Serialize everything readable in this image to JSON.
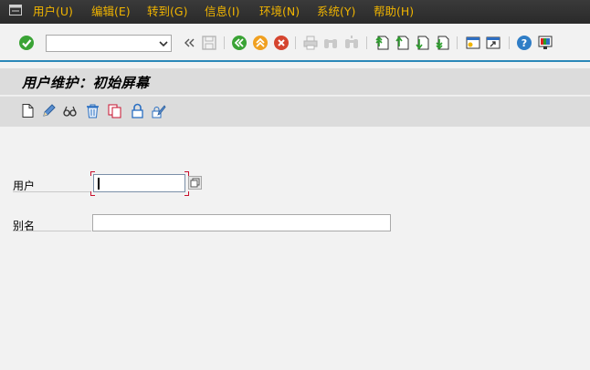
{
  "menubar": {
    "items": [
      "用户(U)",
      "编辑(E)",
      "转到(G)",
      "信息(I)",
      "环境(N)",
      "系统(Y)",
      "帮助(H)"
    ]
  },
  "toolbar": {
    "command_field_value": "",
    "icons": [
      "enter-icon",
      "back-arrows-icon",
      "save-icon",
      "back-icon",
      "exit-icon",
      "cancel-icon",
      "print-icon",
      "find-icon",
      "find-next-icon",
      "first-page-icon",
      "previous-page-icon",
      "next-page-icon",
      "last-page-icon",
      "create-session-icon",
      "shortcut-icon",
      "help-icon",
      "layout-icon"
    ]
  },
  "screen": {
    "title": "用户维护：初始屏幕",
    "app_icons": [
      "create-icon",
      "change-icon",
      "display-icon",
      "delete-icon",
      "copy-icon",
      "lock-icon",
      "change-password-icon"
    ]
  },
  "form": {
    "user_label": "用户",
    "user_value": "",
    "alias_label": "别名",
    "alias_value": ""
  }
}
